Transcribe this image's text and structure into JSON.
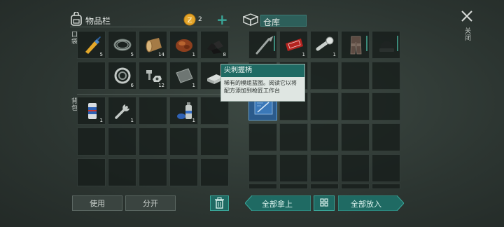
{
  "inventory": {
    "title": "物品栏",
    "currency": {
      "amount": "2",
      "add_label": "+"
    },
    "pocket_label": "口袋",
    "backpack_label": "背包",
    "pocket_counts": [
      "5",
      "5",
      "14",
      "1",
      "8",
      "",
      "6",
      "12",
      "1",
      "1"
    ],
    "backpack_counts": [
      "1",
      "1",
      "",
      "1"
    ]
  },
  "storage": {
    "title": "仓库",
    "counts": [
      "",
      "1",
      "1",
      "",
      ""
    ]
  },
  "tooltip": {
    "title": "尖刺握柄",
    "description": "稀有的模组蓝图。阅读它以将配方添加到枪匠工作台"
  },
  "buttons": {
    "use": "使用",
    "split": "分开",
    "take_all": "全部拿上",
    "put_all": "全部放入",
    "close": "关闭"
  },
  "colors": {
    "accent": "#1f6a63",
    "panel": "#2c3531"
  }
}
